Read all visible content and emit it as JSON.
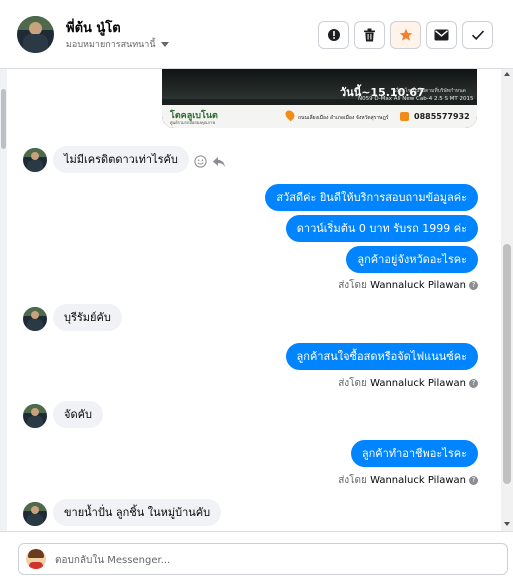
{
  "header": {
    "name": "พี่ต้น นู๋โต",
    "subtitle": "มอบหมายการสนทนานี้"
  },
  "toolbar": {
    "buttons": [
      {
        "icon": "alert-circle-icon",
        "label": "report"
      },
      {
        "icon": "trash-icon",
        "label": "delete"
      },
      {
        "icon": "star-icon",
        "label": "star"
      },
      {
        "icon": "envelope-icon",
        "label": "mark-unread"
      },
      {
        "icon": "check-icon",
        "label": "done"
      }
    ],
    "accent_star": "#f5822a"
  },
  "banner": {
    "date": "วันนี้~15.10.67",
    "fine_print": "*เงื่อนไขเป็นไปตามที่บริษัทกำหนด",
    "model": "N059  D-Max All New Cab-4 2.5 S MT 2015",
    "logo": "โตคลูเบโนต",
    "logo_sub": "ศูนย์รวมรถมือสองคุณภาพ",
    "address": "ถนนเลี่ยงเมือง อำเภอเมือง จังหวัดสุราษฎร์",
    "phone": "0885577932"
  },
  "messages": {
    "m1": "ไม่มีเครดิตดาวเท่าไรคับ",
    "m2": "สวัสดีค่ะ  ยินดีให้บริการสอบถามข้อมูลค่ะ",
    "m3": "ดาวน์เริ่มต้น 0 บาท รับรถ 1999 ค่ะ",
    "m4": "ลูกค้าอยู่จังหวัดอะไรคะ",
    "m5": "บุรีรัมย์คับ",
    "m6": "ลูกค้าสนใจซื้อสดหรือจัดไฟแนนซ์คะ",
    "m7": "จัดคับ",
    "m8": "ลูกค้าทำอาชีพอะไรคะ",
    "m9": "ขายน้ำปั่น ลูกชิ้น ในหมู่บ้านคับ"
  },
  "sent_by": {
    "prefix": "ส่งโดย",
    "agent": "Wannaluck Pilawan"
  },
  "composer": {
    "placeholder": "ตอบกลับใน Messenger..."
  },
  "colors": {
    "outgoing_bubble": "#0084ff",
    "incoming_bubble": "#f0f2f5"
  }
}
